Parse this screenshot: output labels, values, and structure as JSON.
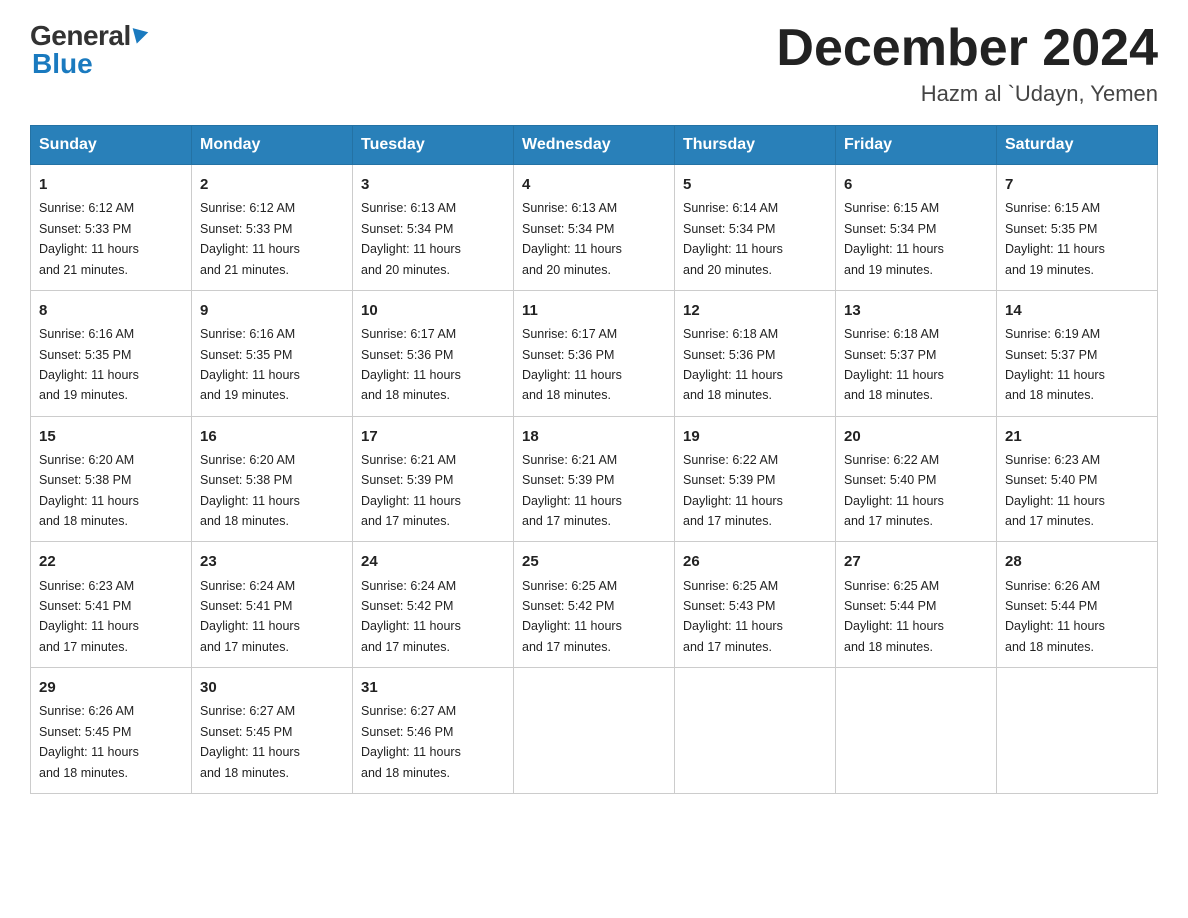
{
  "header": {
    "logo_general": "General",
    "logo_blue": "Blue",
    "month_title": "December 2024",
    "location": "Hazm al `Udayn, Yemen"
  },
  "days_of_week": [
    "Sunday",
    "Monday",
    "Tuesday",
    "Wednesday",
    "Thursday",
    "Friday",
    "Saturday"
  ],
  "weeks": [
    [
      {
        "day": "1",
        "sunrise": "6:12 AM",
        "sunset": "5:33 PM",
        "daylight": "11 hours and 21 minutes."
      },
      {
        "day": "2",
        "sunrise": "6:12 AM",
        "sunset": "5:33 PM",
        "daylight": "11 hours and 21 minutes."
      },
      {
        "day": "3",
        "sunrise": "6:13 AM",
        "sunset": "5:34 PM",
        "daylight": "11 hours and 20 minutes."
      },
      {
        "day": "4",
        "sunrise": "6:13 AM",
        "sunset": "5:34 PM",
        "daylight": "11 hours and 20 minutes."
      },
      {
        "day": "5",
        "sunrise": "6:14 AM",
        "sunset": "5:34 PM",
        "daylight": "11 hours and 20 minutes."
      },
      {
        "day": "6",
        "sunrise": "6:15 AM",
        "sunset": "5:34 PM",
        "daylight": "11 hours and 19 minutes."
      },
      {
        "day": "7",
        "sunrise": "6:15 AM",
        "sunset": "5:35 PM",
        "daylight": "11 hours and 19 minutes."
      }
    ],
    [
      {
        "day": "8",
        "sunrise": "6:16 AM",
        "sunset": "5:35 PM",
        "daylight": "11 hours and 19 minutes."
      },
      {
        "day": "9",
        "sunrise": "6:16 AM",
        "sunset": "5:35 PM",
        "daylight": "11 hours and 19 minutes."
      },
      {
        "day": "10",
        "sunrise": "6:17 AM",
        "sunset": "5:36 PM",
        "daylight": "11 hours and 18 minutes."
      },
      {
        "day": "11",
        "sunrise": "6:17 AM",
        "sunset": "5:36 PM",
        "daylight": "11 hours and 18 minutes."
      },
      {
        "day": "12",
        "sunrise": "6:18 AM",
        "sunset": "5:36 PM",
        "daylight": "11 hours and 18 minutes."
      },
      {
        "day": "13",
        "sunrise": "6:18 AM",
        "sunset": "5:37 PM",
        "daylight": "11 hours and 18 minutes."
      },
      {
        "day": "14",
        "sunrise": "6:19 AM",
        "sunset": "5:37 PM",
        "daylight": "11 hours and 18 minutes."
      }
    ],
    [
      {
        "day": "15",
        "sunrise": "6:20 AM",
        "sunset": "5:38 PM",
        "daylight": "11 hours and 18 minutes."
      },
      {
        "day": "16",
        "sunrise": "6:20 AM",
        "sunset": "5:38 PM",
        "daylight": "11 hours and 18 minutes."
      },
      {
        "day": "17",
        "sunrise": "6:21 AM",
        "sunset": "5:39 PM",
        "daylight": "11 hours and 17 minutes."
      },
      {
        "day": "18",
        "sunrise": "6:21 AM",
        "sunset": "5:39 PM",
        "daylight": "11 hours and 17 minutes."
      },
      {
        "day": "19",
        "sunrise": "6:22 AM",
        "sunset": "5:39 PM",
        "daylight": "11 hours and 17 minutes."
      },
      {
        "day": "20",
        "sunrise": "6:22 AM",
        "sunset": "5:40 PM",
        "daylight": "11 hours and 17 minutes."
      },
      {
        "day": "21",
        "sunrise": "6:23 AM",
        "sunset": "5:40 PM",
        "daylight": "11 hours and 17 minutes."
      }
    ],
    [
      {
        "day": "22",
        "sunrise": "6:23 AM",
        "sunset": "5:41 PM",
        "daylight": "11 hours and 17 minutes."
      },
      {
        "day": "23",
        "sunrise": "6:24 AM",
        "sunset": "5:41 PM",
        "daylight": "11 hours and 17 minutes."
      },
      {
        "day": "24",
        "sunrise": "6:24 AM",
        "sunset": "5:42 PM",
        "daylight": "11 hours and 17 minutes."
      },
      {
        "day": "25",
        "sunrise": "6:25 AM",
        "sunset": "5:42 PM",
        "daylight": "11 hours and 17 minutes."
      },
      {
        "day": "26",
        "sunrise": "6:25 AM",
        "sunset": "5:43 PM",
        "daylight": "11 hours and 17 minutes."
      },
      {
        "day": "27",
        "sunrise": "6:25 AM",
        "sunset": "5:44 PM",
        "daylight": "11 hours and 18 minutes."
      },
      {
        "day": "28",
        "sunrise": "6:26 AM",
        "sunset": "5:44 PM",
        "daylight": "11 hours and 18 minutes."
      }
    ],
    [
      {
        "day": "29",
        "sunrise": "6:26 AM",
        "sunset": "5:45 PM",
        "daylight": "11 hours and 18 minutes."
      },
      {
        "day": "30",
        "sunrise": "6:27 AM",
        "sunset": "5:45 PM",
        "daylight": "11 hours and 18 minutes."
      },
      {
        "day": "31",
        "sunrise": "6:27 AM",
        "sunset": "5:46 PM",
        "daylight": "11 hours and 18 minutes."
      },
      null,
      null,
      null,
      null
    ]
  ],
  "labels": {
    "sunrise": "Sunrise:",
    "sunset": "Sunset:",
    "daylight": "Daylight:"
  }
}
